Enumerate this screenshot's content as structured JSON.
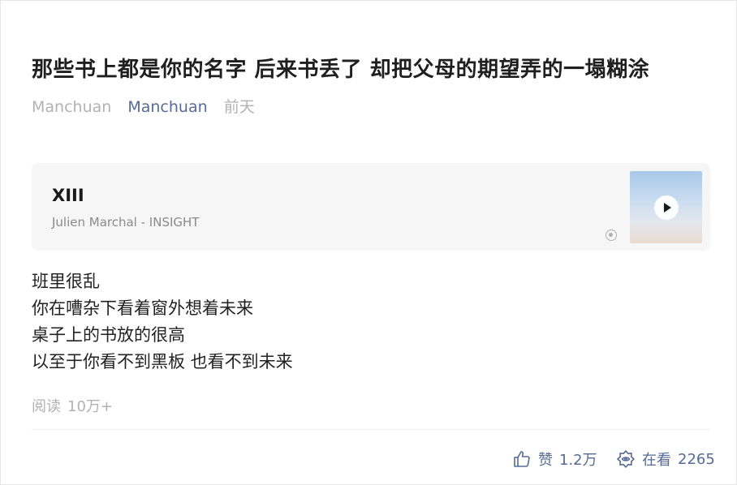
{
  "article": {
    "title": "那些书上都是你的名字 后来书丢了 却把父母的期望弄的一塌糊涂",
    "author": "Manchuan",
    "account": "Manchuan",
    "time": "前天"
  },
  "music": {
    "title": "XIII",
    "artist": "Julien Marchal - INSIGHT",
    "source_icon": "qq-music-icon",
    "play_icon": "play-icon"
  },
  "body": {
    "lines": [
      "班里很乱",
      "你在嘈杂下看着窗外想着未来",
      "桌子上的书放的很高",
      "以至于你看不到黑板 也看不到未来"
    ]
  },
  "stats": {
    "read_label": "阅读",
    "read_count": "10万+",
    "like_label": "赞",
    "like_count": "1.2万",
    "watch_label": "在看",
    "watch_count": "2265"
  },
  "colors": {
    "link": "#576b95",
    "muted": "#b2b2b2",
    "card_bg": "#f6f6f6"
  }
}
